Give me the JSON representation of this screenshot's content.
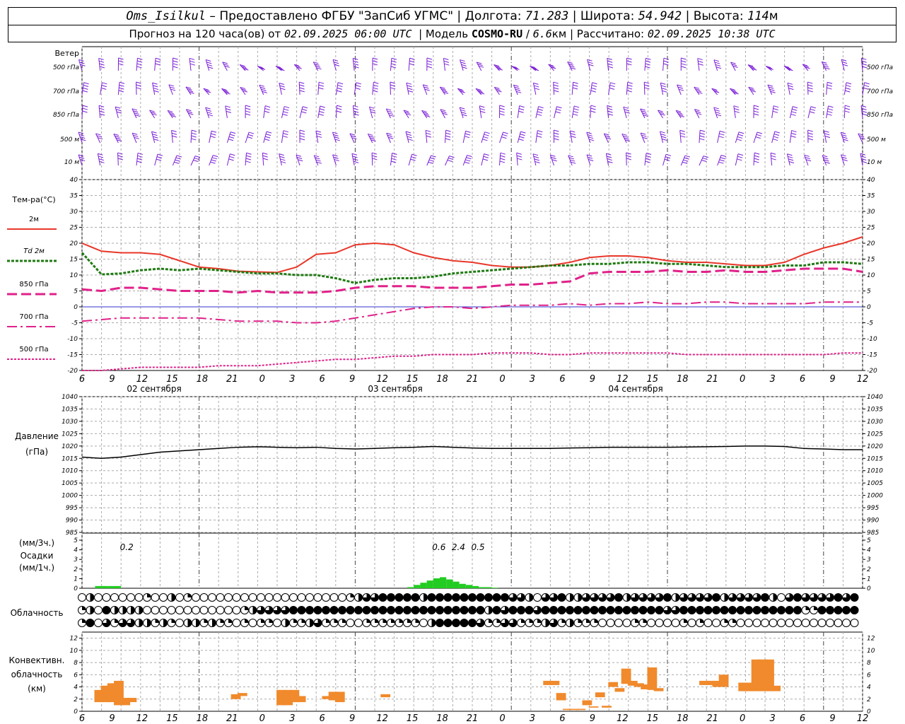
{
  "header": {
    "station": "Oms_Isilkul",
    "provider": "Предоставлено ФГБУ \"ЗапСиб УГМС\"",
    "lon_label": "Долгота:",
    "lon": "71.283",
    "lat_label": "Широта:",
    "lat": "54.942",
    "alt_label": "Высота:",
    "alt": "114",
    "alt_unit": "м",
    "forecast_label": "Прогноз на 120 часа(ов) от",
    "forecast_start": "02.09.2025 06:00 UTC",
    "model_label": "Модель",
    "model": "COSMO-RU",
    "model_res": "6.6",
    "model_res_unit": "км",
    "calc_label": "Рассчитано:",
    "calc_time": "02.09.2025 10:38 UTC"
  },
  "x_axis": {
    "hour_ticks": [
      "6",
      "9",
      "12",
      "15",
      "18",
      "21",
      "0",
      "3",
      "6",
      "9",
      "12",
      "15",
      "18",
      "21",
      "0",
      "3",
      "6",
      "9",
      "12",
      "15",
      "18",
      "21",
      "0",
      "3",
      "6",
      "9",
      "12"
    ],
    "day_labels": [
      "02 сентября",
      "03 сентября",
      "04 сентября"
    ]
  },
  "wind_panel": {
    "title": "Ветер",
    "levels": [
      "500 гПа",
      "700 гПа",
      "850 гПа",
      "500 м",
      "10 м"
    ],
    "barb_color": "#7b1fd6"
  },
  "chart_data": [
    {
      "type": "line",
      "panel": "temperature",
      "title": "Тем-ра(°C)",
      "ylim": [
        -20,
        40
      ],
      "yticks": [
        "40",
        "35",
        "30",
        "25",
        "20",
        "15",
        "10",
        "5",
        "0",
        "-5",
        "-10",
        "-15",
        "-20"
      ],
      "x_hours": [
        0,
        3,
        6,
        9,
        12,
        15,
        18,
        21,
        24,
        27,
        30,
        33,
        36,
        39,
        42,
        45,
        48,
        51,
        54,
        57,
        60,
        63,
        66,
        69,
        72,
        75,
        78,
        81,
        84,
        87,
        90,
        93,
        96,
        99,
        102,
        105,
        108,
        111,
        114,
        117,
        120
      ],
      "series": [
        {
          "name": "2м",
          "color": "#e8372a",
          "values": [
            20,
            17.5,
            17,
            17,
            16.5,
            14.5,
            12.5,
            12,
            11.2,
            11,
            10.8,
            12.5,
            16.5,
            17,
            19.5,
            20,
            19.5,
            17,
            15.5,
            14.5,
            14,
            13,
            12.5,
            12.5,
            13,
            14,
            15.5,
            16,
            16,
            15.5,
            14.5,
            14,
            14,
            13.5,
            13,
            13,
            14,
            16.5,
            18.5,
            20,
            22
          ]
        },
        {
          "name": "Td 2м",
          "color": "#1f7a12",
          "values": [
            17,
            10.2,
            10.5,
            11.5,
            12,
            11.5,
            12,
            11.5,
            11,
            10.5,
            10.5,
            10,
            10,
            9,
            7.5,
            8.5,
            9,
            9,
            9.5,
            10.5,
            11,
            11.5,
            12,
            12.5,
            13,
            13,
            13.5,
            13.5,
            14,
            14,
            13.5,
            13.5,
            13,
            12.5,
            12.5,
            12.5,
            13,
            13,
            14,
            14,
            13.5
          ]
        },
        {
          "name": "850 гПа",
          "color": "#e0218a",
          "values": [
            5.5,
            5,
            6,
            6,
            5.5,
            5,
            5,
            5,
            4.5,
            5,
            4.5,
            4.5,
            4.5,
            5,
            6,
            6.5,
            6.5,
            6.5,
            6,
            6,
            6,
            6.5,
            7,
            7,
            7.5,
            8,
            10.5,
            11,
            11,
            11,
            11.5,
            11,
            11,
            11.5,
            11,
            11,
            11.5,
            12,
            12,
            12,
            11
          ]
        },
        {
          "name": "700 гПа",
          "color": "#e0218a",
          "values": [
            -4.5,
            -4,
            -3.5,
            -3.5,
            -3.5,
            -3.5,
            -3.5,
            -4,
            -4.5,
            -4.5,
            -4.5,
            -5,
            -5,
            -4.5,
            -3.5,
            -2.5,
            -1.5,
            -0.5,
            0,
            0,
            -0.5,
            0,
            0.5,
            0.5,
            0.5,
            1,
            0.5,
            1,
            1,
            1.5,
            1,
            1,
            1.5,
            1.5,
            1,
            1,
            1,
            1,
            1.5,
            1.5,
            1.5
          ]
        },
        {
          "name": "500 гПа",
          "color": "#e0218a",
          "values": [
            -20,
            -20,
            -19.5,
            -19,
            -19,
            -19,
            -19,
            -18.5,
            -18.5,
            -18.5,
            -18,
            -17.5,
            -17,
            -16.5,
            -16.5,
            -16,
            -15.5,
            -15.5,
            -15,
            -15,
            -15,
            -14.5,
            -14.5,
            -14.5,
            -15,
            -15,
            -14.5,
            -14.5,
            -14.5,
            -14.5,
            -14.5,
            -15,
            -15,
            -15,
            -15,
            -15,
            -15,
            -15,
            -15,
            -14.5,
            -14.5
          ]
        }
      ]
    },
    {
      "type": "line",
      "panel": "pressure",
      "title": "Давление",
      "ylabel": "(гПа)",
      "ylim": [
        985,
        1040
      ],
      "yticks": [
        "1040",
        "1035",
        "1030",
        "1025",
        "1020",
        "1015",
        "1010",
        "1005",
        "1000",
        "995",
        "990",
        "985"
      ],
      "x_hours": [
        0,
        3,
        6,
        9,
        12,
        15,
        18,
        21,
        24,
        27,
        30,
        33,
        36,
        39,
        42,
        45,
        48,
        51,
        54,
        57,
        60,
        63,
        66,
        69,
        72,
        75,
        78,
        81,
        84,
        87,
        90,
        93,
        96,
        99,
        102,
        105,
        108,
        111,
        114,
        117,
        120
      ],
      "series": [
        {
          "color": "#000000",
          "values": [
            1015.5,
            1015,
            1015.5,
            1016.5,
            1017.5,
            1018,
            1018.5,
            1019,
            1019.5,
            1019.7,
            1019.5,
            1019.3,
            1019.5,
            1019,
            1018.8,
            1019,
            1019.3,
            1019.5,
            1019.8,
            1019.5,
            1019.2,
            1019,
            1019,
            1019,
            1019,
            1019.2,
            1019.3,
            1019.5,
            1019.5,
            1019.5,
            1019.5,
            1019.6,
            1019.7,
            1019.8,
            1020,
            1020,
            1019.8,
            1019,
            1018.8,
            1018.5,
            1018.5
          ]
        }
      ]
    },
    {
      "type": "bar",
      "panel": "precipitation",
      "title": "Осадки",
      "ylabel_top": "(мм/3ч.)",
      "ylabel_bottom": "(мм/1ч.)",
      "ylim": [
        0,
        5
      ],
      "yticks": [
        "5",
        "4",
        "3",
        "2",
        "1",
        "0"
      ],
      "bar_color": "#22cc22",
      "x_hours": [
        3,
        4,
        5,
        6,
        51,
        52,
        53,
        54,
        55,
        56,
        57,
        58,
        59,
        60,
        61,
        62,
        63,
        64
      ],
      "values": [
        0.2,
        0.2,
        0.2,
        0.2,
        0.1,
        0.3,
        0.5,
        0.7,
        0.9,
        1.0,
        0.8,
        0.6,
        0.4,
        0.3,
        0.2,
        0.1,
        0.1,
        0.05
      ],
      "totals_3h": [
        {
          "hour": 6,
          "label": "0.2"
        },
        {
          "hour": 54,
          "label": "0.6"
        },
        {
          "hour": 57,
          "label": "2.4"
        },
        {
          "hour": 60,
          "label": "0.5"
        }
      ]
    },
    {
      "type": "bar",
      "panel": "convective_cloud",
      "title": "Конвективн. облачность",
      "ylabel": "(км)",
      "ylim": [
        0,
        13
      ],
      "yticks": [
        "12",
        "10",
        "8",
        "6",
        "4",
        "2",
        "0"
      ],
      "bar_color": "#f08a2c",
      "bars": [
        {
          "hour": 3,
          "base": 1.5,
          "top": 3.5
        },
        {
          "hour": 4,
          "base": 1.5,
          "top": 4.2
        },
        {
          "hour": 5,
          "base": 1.5,
          "top": 4.6
        },
        {
          "hour": 6,
          "base": 1,
          "top": 5
        },
        {
          "hour": 7,
          "base": 1,
          "top": 2.2
        },
        {
          "hour": 8,
          "base": 1.5,
          "top": 2.2
        },
        {
          "hour": 24,
          "base": 2,
          "top": 2.8
        },
        {
          "hour": 25,
          "base": 2.5,
          "top": 3
        },
        {
          "hour": 31,
          "base": 1,
          "top": 3.5
        },
        {
          "hour": 32,
          "base": 1,
          "top": 3.5
        },
        {
          "hour": 33,
          "base": 1.5,
          "top": 3.5
        },
        {
          "hour": 34,
          "base": 1.5,
          "top": 2.5
        },
        {
          "hour": 38,
          "base": 2,
          "top": 2.5
        },
        {
          "hour": 39,
          "base": 1.8,
          "top": 3.2
        },
        {
          "hour": 40,
          "base": 1.5,
          "top": 3.2
        },
        {
          "hour": 47,
          "base": 2.3,
          "top": 2.8
        },
        {
          "hour": 72,
          "base": 4.3,
          "top": 5
        },
        {
          "hour": 73,
          "base": 4.3,
          "top": 5
        },
        {
          "hour": 74,
          "base": 1.8,
          "top": 3
        },
        {
          "hour": 75,
          "base": 0.2,
          "top": 0.4
        },
        {
          "hour": 76,
          "base": 0.2,
          "top": 0.4
        },
        {
          "hour": 77,
          "base": 0.2,
          "top": 0.4
        },
        {
          "hour": 78,
          "base": 1,
          "top": 1.8
        },
        {
          "hour": 79,
          "base": 0.6,
          "top": 0.8
        },
        {
          "hour": 80,
          "base": 2.3,
          "top": 3.1
        },
        {
          "hour": 81,
          "base": 0.6,
          "top": 0.9
        },
        {
          "hour": 82,
          "base": 4,
          "top": 4.8
        },
        {
          "hour": 83,
          "base": 3.2,
          "top": 3.8
        },
        {
          "hour": 84,
          "base": 4.5,
          "top": 7
        },
        {
          "hour": 85,
          "base": 4.2,
          "top": 5
        },
        {
          "hour": 86,
          "base": 4,
          "top": 4.6
        },
        {
          "hour": 87,
          "base": 3.6,
          "top": 4.4
        },
        {
          "hour": 88,
          "base": 3.5,
          "top": 7.2
        },
        {
          "hour": 89,
          "base": 3.3,
          "top": 3.8
        },
        {
          "hour": 96,
          "base": 4.3,
          "top": 5
        },
        {
          "hour": 97,
          "base": 4.3,
          "top": 5
        },
        {
          "hour": 98,
          "base": 4,
          "top": 5
        },
        {
          "hour": 99,
          "base": 4,
          "top": 6
        },
        {
          "hour": 102,
          "base": 3.3,
          "top": 4.7
        },
        {
          "hour": 103,
          "base": 3.3,
          "top": 4.7
        },
        {
          "hour": 104,
          "base": 3.3,
          "top": 8.5
        },
        {
          "hour": 105,
          "base": 3.3,
          "top": 8.5
        },
        {
          "hour": 106,
          "base": 3.3,
          "top": 8.5
        },
        {
          "hour": 107,
          "base": 3.3,
          "top": 4.2
        }
      ]
    }
  ],
  "cloud_panel": {
    "title": "Облачность",
    "rows": [
      "020000001002010000000000000000000123344444244444444443320334223333423333423333423333420343333434",
      "120422220000000000001233334444444444444444444444442434443444444444444444334444444444444441144444",
      "140313322121022121101011021123111001111111024444431133111231211100001100001010011000000000000000"
    ]
  }
}
